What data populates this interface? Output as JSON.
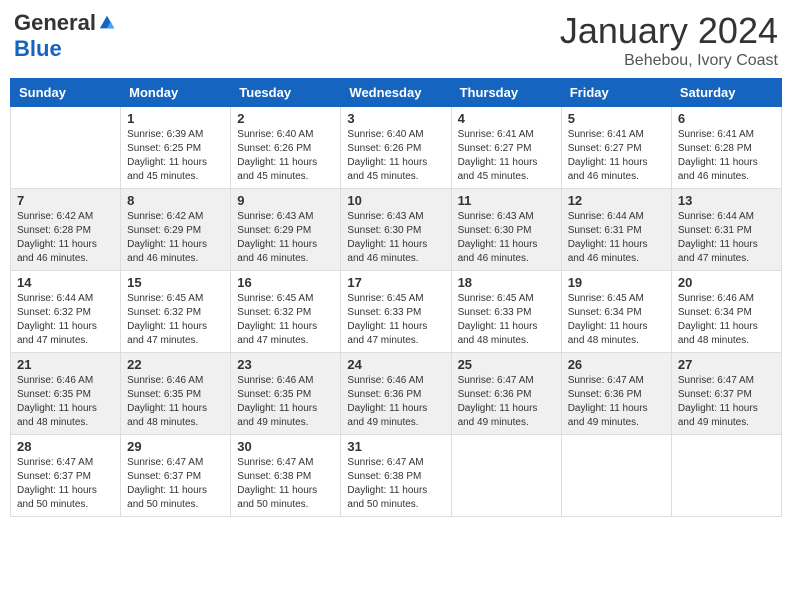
{
  "header": {
    "logo_general": "General",
    "logo_blue": "Blue",
    "month_title": "January 2024",
    "subtitle": "Behebou, Ivory Coast"
  },
  "days_of_week": [
    "Sunday",
    "Monday",
    "Tuesday",
    "Wednesday",
    "Thursday",
    "Friday",
    "Saturday"
  ],
  "weeks": [
    [
      {
        "day": "",
        "sunrise": "",
        "sunset": "",
        "daylight": ""
      },
      {
        "day": "1",
        "sunrise": "Sunrise: 6:39 AM",
        "sunset": "Sunset: 6:25 PM",
        "daylight": "Daylight: 11 hours and 45 minutes."
      },
      {
        "day": "2",
        "sunrise": "Sunrise: 6:40 AM",
        "sunset": "Sunset: 6:26 PM",
        "daylight": "Daylight: 11 hours and 45 minutes."
      },
      {
        "day": "3",
        "sunrise": "Sunrise: 6:40 AM",
        "sunset": "Sunset: 6:26 PM",
        "daylight": "Daylight: 11 hours and 45 minutes."
      },
      {
        "day": "4",
        "sunrise": "Sunrise: 6:41 AM",
        "sunset": "Sunset: 6:27 PM",
        "daylight": "Daylight: 11 hours and 45 minutes."
      },
      {
        "day": "5",
        "sunrise": "Sunrise: 6:41 AM",
        "sunset": "Sunset: 6:27 PM",
        "daylight": "Daylight: 11 hours and 46 minutes."
      },
      {
        "day": "6",
        "sunrise": "Sunrise: 6:41 AM",
        "sunset": "Sunset: 6:28 PM",
        "daylight": "Daylight: 11 hours and 46 minutes."
      }
    ],
    [
      {
        "day": "7",
        "sunrise": "Sunrise: 6:42 AM",
        "sunset": "Sunset: 6:28 PM",
        "daylight": "Daylight: 11 hours and 46 minutes."
      },
      {
        "day": "8",
        "sunrise": "Sunrise: 6:42 AM",
        "sunset": "Sunset: 6:29 PM",
        "daylight": "Daylight: 11 hours and 46 minutes."
      },
      {
        "day": "9",
        "sunrise": "Sunrise: 6:43 AM",
        "sunset": "Sunset: 6:29 PM",
        "daylight": "Daylight: 11 hours and 46 minutes."
      },
      {
        "day": "10",
        "sunrise": "Sunrise: 6:43 AM",
        "sunset": "Sunset: 6:30 PM",
        "daylight": "Daylight: 11 hours and 46 minutes."
      },
      {
        "day": "11",
        "sunrise": "Sunrise: 6:43 AM",
        "sunset": "Sunset: 6:30 PM",
        "daylight": "Daylight: 11 hours and 46 minutes."
      },
      {
        "day": "12",
        "sunrise": "Sunrise: 6:44 AM",
        "sunset": "Sunset: 6:31 PM",
        "daylight": "Daylight: 11 hours and 46 minutes."
      },
      {
        "day": "13",
        "sunrise": "Sunrise: 6:44 AM",
        "sunset": "Sunset: 6:31 PM",
        "daylight": "Daylight: 11 hours and 47 minutes."
      }
    ],
    [
      {
        "day": "14",
        "sunrise": "Sunrise: 6:44 AM",
        "sunset": "Sunset: 6:32 PM",
        "daylight": "Daylight: 11 hours and 47 minutes."
      },
      {
        "day": "15",
        "sunrise": "Sunrise: 6:45 AM",
        "sunset": "Sunset: 6:32 PM",
        "daylight": "Daylight: 11 hours and 47 minutes."
      },
      {
        "day": "16",
        "sunrise": "Sunrise: 6:45 AM",
        "sunset": "Sunset: 6:32 PM",
        "daylight": "Daylight: 11 hours and 47 minutes."
      },
      {
        "day": "17",
        "sunrise": "Sunrise: 6:45 AM",
        "sunset": "Sunset: 6:33 PM",
        "daylight": "Daylight: 11 hours and 47 minutes."
      },
      {
        "day": "18",
        "sunrise": "Sunrise: 6:45 AM",
        "sunset": "Sunset: 6:33 PM",
        "daylight": "Daylight: 11 hours and 48 minutes."
      },
      {
        "day": "19",
        "sunrise": "Sunrise: 6:45 AM",
        "sunset": "Sunset: 6:34 PM",
        "daylight": "Daylight: 11 hours and 48 minutes."
      },
      {
        "day": "20",
        "sunrise": "Sunrise: 6:46 AM",
        "sunset": "Sunset: 6:34 PM",
        "daylight": "Daylight: 11 hours and 48 minutes."
      }
    ],
    [
      {
        "day": "21",
        "sunrise": "Sunrise: 6:46 AM",
        "sunset": "Sunset: 6:35 PM",
        "daylight": "Daylight: 11 hours and 48 minutes."
      },
      {
        "day": "22",
        "sunrise": "Sunrise: 6:46 AM",
        "sunset": "Sunset: 6:35 PM",
        "daylight": "Daylight: 11 hours and 48 minutes."
      },
      {
        "day": "23",
        "sunrise": "Sunrise: 6:46 AM",
        "sunset": "Sunset: 6:35 PM",
        "daylight": "Daylight: 11 hours and 49 minutes."
      },
      {
        "day": "24",
        "sunrise": "Sunrise: 6:46 AM",
        "sunset": "Sunset: 6:36 PM",
        "daylight": "Daylight: 11 hours and 49 minutes."
      },
      {
        "day": "25",
        "sunrise": "Sunrise: 6:47 AM",
        "sunset": "Sunset: 6:36 PM",
        "daylight": "Daylight: 11 hours and 49 minutes."
      },
      {
        "day": "26",
        "sunrise": "Sunrise: 6:47 AM",
        "sunset": "Sunset: 6:36 PM",
        "daylight": "Daylight: 11 hours and 49 minutes."
      },
      {
        "day": "27",
        "sunrise": "Sunrise: 6:47 AM",
        "sunset": "Sunset: 6:37 PM",
        "daylight": "Daylight: 11 hours and 49 minutes."
      }
    ],
    [
      {
        "day": "28",
        "sunrise": "Sunrise: 6:47 AM",
        "sunset": "Sunset: 6:37 PM",
        "daylight": "Daylight: 11 hours and 50 minutes."
      },
      {
        "day": "29",
        "sunrise": "Sunrise: 6:47 AM",
        "sunset": "Sunset: 6:37 PM",
        "daylight": "Daylight: 11 hours and 50 minutes."
      },
      {
        "day": "30",
        "sunrise": "Sunrise: 6:47 AM",
        "sunset": "Sunset: 6:38 PM",
        "daylight": "Daylight: 11 hours and 50 minutes."
      },
      {
        "day": "31",
        "sunrise": "Sunrise: 6:47 AM",
        "sunset": "Sunset: 6:38 PM",
        "daylight": "Daylight: 11 hours and 50 minutes."
      },
      {
        "day": "",
        "sunrise": "",
        "sunset": "",
        "daylight": ""
      },
      {
        "day": "",
        "sunrise": "",
        "sunset": "",
        "daylight": ""
      },
      {
        "day": "",
        "sunrise": "",
        "sunset": "",
        "daylight": ""
      }
    ]
  ]
}
